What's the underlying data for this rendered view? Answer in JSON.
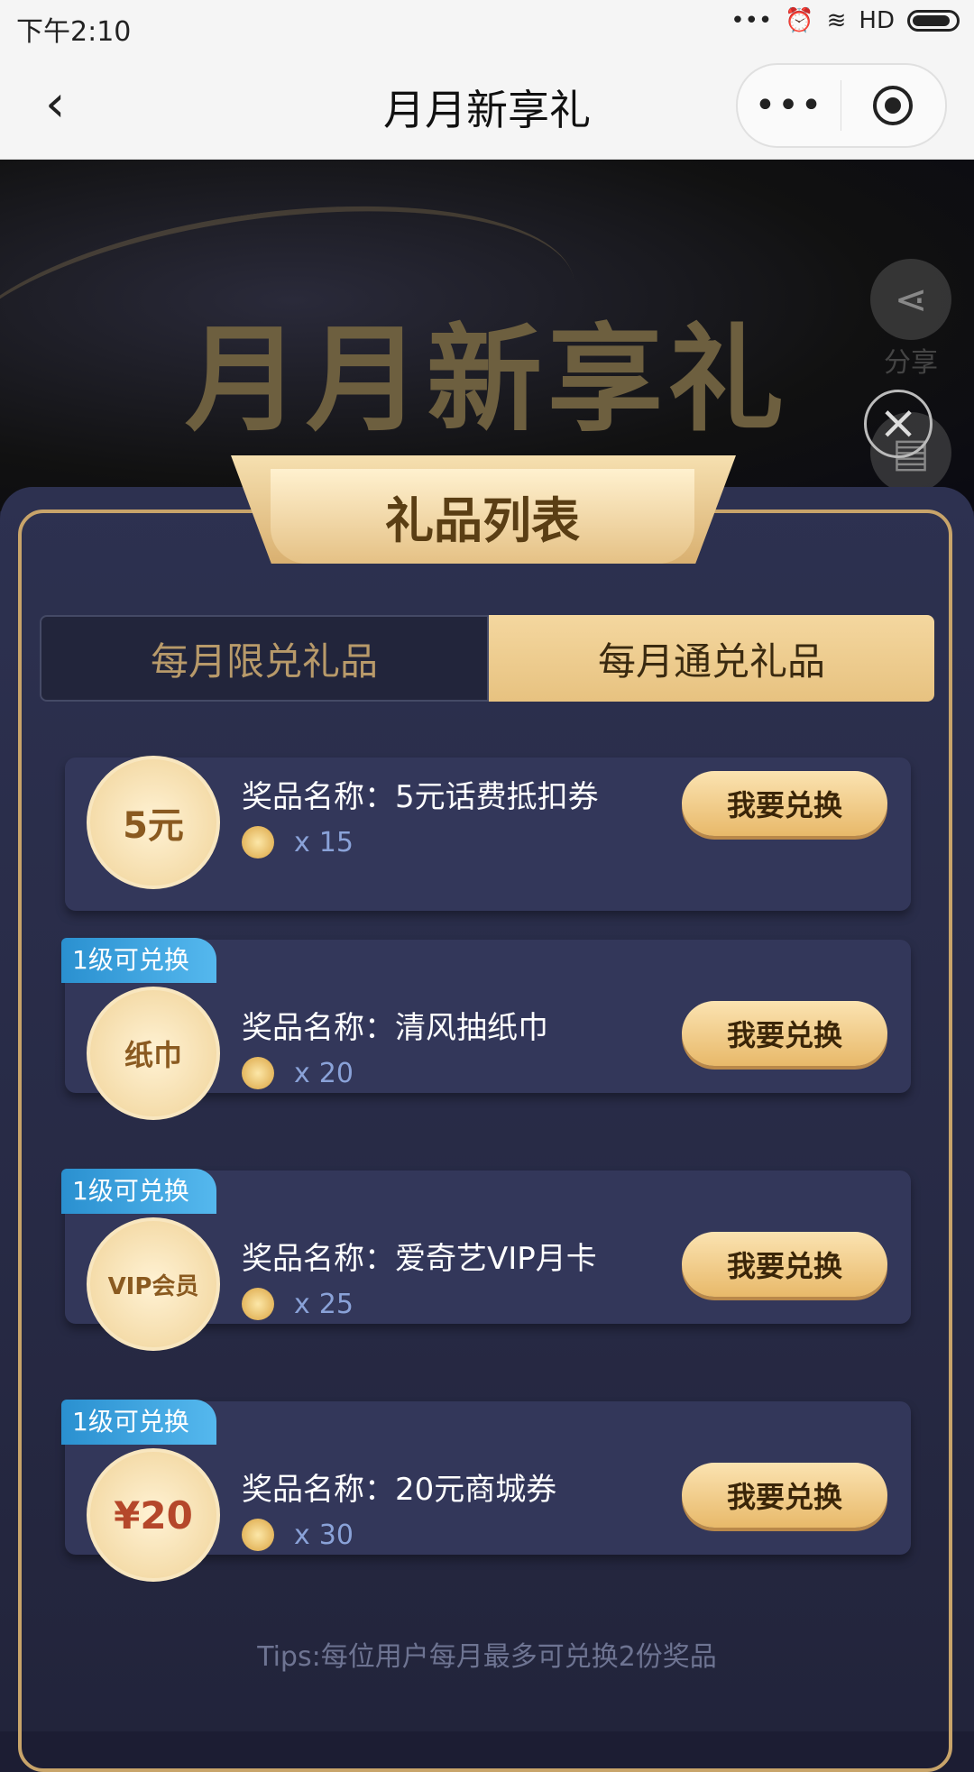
{
  "status": {
    "time": "下午2:10",
    "signal": "HD",
    "dots": "•••"
  },
  "nav": {
    "back": "‹",
    "title": "月月新享礼",
    "more": "•••"
  },
  "hero": {
    "title": "月月新享礼",
    "share_label": "分享",
    "rules_label": "规则",
    "close": "×"
  },
  "panel": {
    "ribbon_title": "礼品列表"
  },
  "tabs": [
    {
      "label": "每月限兑礼品",
      "active": false
    },
    {
      "label": "每月通兑礼品",
      "active": true
    }
  ],
  "gifts": [
    {
      "badge": "",
      "thumb": "5元",
      "name": "奖品名称：5元话费抵扣券",
      "cost_x": "x",
      "cost": "15",
      "button": "我要兑换"
    },
    {
      "badge": "1级可兑换",
      "thumb": "纸巾",
      "name": "奖品名称：清风抽纸巾",
      "cost_x": "x",
      "cost": "20",
      "button": "我要兑换"
    },
    {
      "badge": "1级可兑换",
      "thumb": "VIP会员",
      "name": "奖品名称：爱奇艺VIP月卡",
      "cost_x": "x",
      "cost": "25",
      "button": "我要兑换"
    },
    {
      "badge": "1级可兑换",
      "thumb": "¥20",
      "name": "奖品名称：20元商城券",
      "cost_x": "x",
      "cost": "30",
      "button": "我要兑换"
    }
  ],
  "tips": "Tips:每位用户每月最多可兑换2份奖品",
  "colors": {
    "gold": "#c8a46a",
    "panel": "#2d3150",
    "badge": "#2a90d0"
  }
}
